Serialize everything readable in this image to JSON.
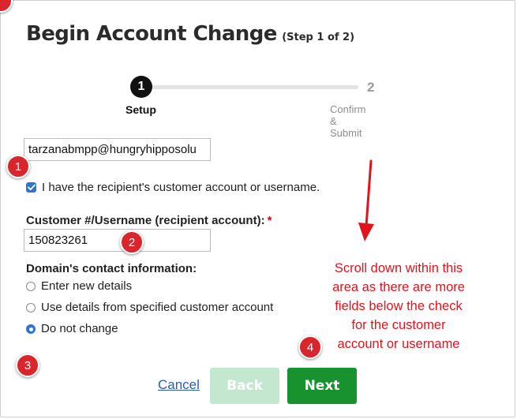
{
  "header": {
    "title": "Begin Account Change",
    "subtitle": "(Step 1 of 2)"
  },
  "stepper": {
    "steps": [
      {
        "number": "1",
        "label": "Setup",
        "active": true
      },
      {
        "number": "2",
        "label": "Confirm & Submit",
        "active": false
      }
    ]
  },
  "form": {
    "email_value": "tarzanabmpp@hungryhipposolu",
    "checkbox_label": "I have the recipient's customer account or username.",
    "checkbox_checked": true,
    "customer_label": "Customer #/Username (recipient account):",
    "required_mark": "*",
    "customer_value": "150823261",
    "domain_label": "Domain's contact information:",
    "radio_options": [
      {
        "label": "Enter new details",
        "checked": false
      },
      {
        "label": "Use details from specified customer account",
        "checked": false
      },
      {
        "label": "Do not change",
        "checked": true
      }
    ]
  },
  "actions": {
    "cancel_label": "Cancel",
    "back_label": "Back",
    "next_label": "Next"
  },
  "annotations": {
    "markers": [
      "1",
      "2",
      "3",
      "4"
    ],
    "note_lines": [
      "Scroll down within this",
      "area as there are more",
      "fields below the check",
      "for the customer",
      "account or username"
    ]
  },
  "colors": {
    "accent_blue": "#2f74d0",
    "primary_green": "#17922f",
    "disabled_green": "#c3e8cf",
    "annotation_red": "#e0141d",
    "link_blue": "#2a5db0"
  }
}
